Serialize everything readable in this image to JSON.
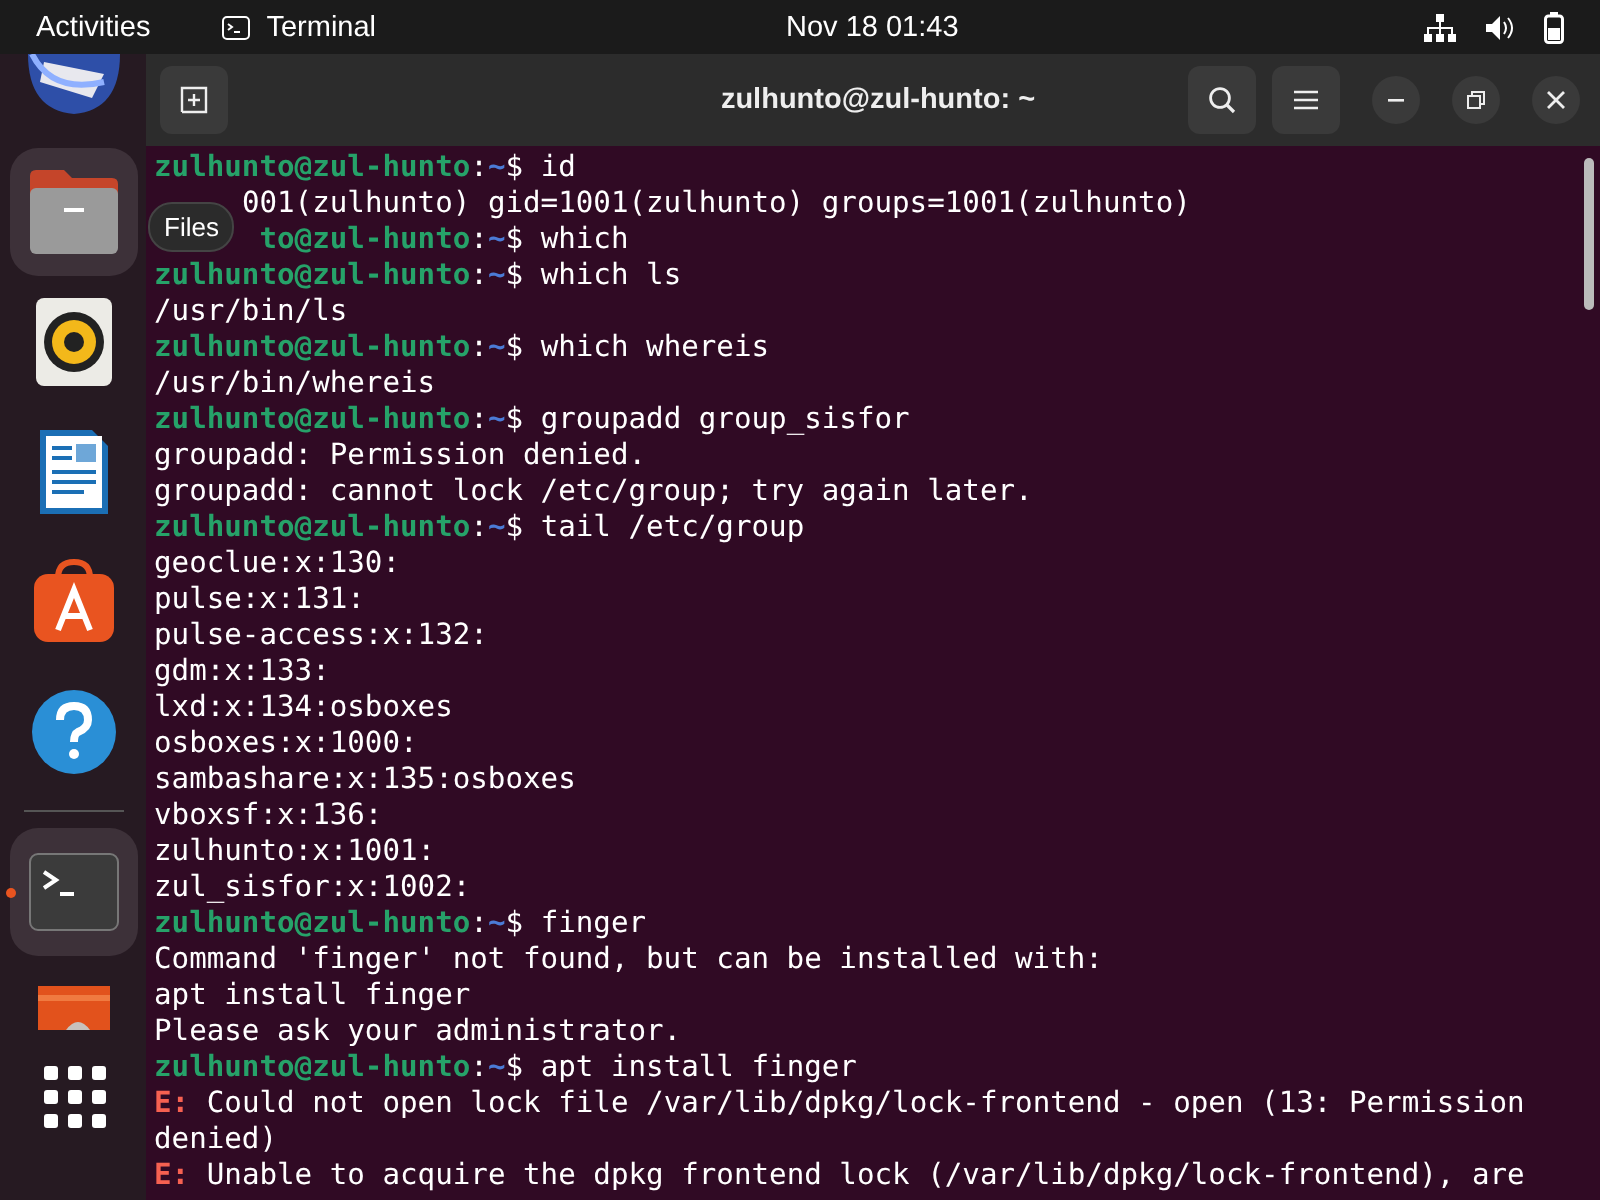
{
  "top_bar": {
    "activities": "Activities",
    "app_name": "Terminal",
    "clock": "Nov 18  01:43"
  },
  "dock": {
    "items": [
      {
        "kind": "mail",
        "selected": false,
        "running": false
      },
      {
        "kind": "files",
        "selected": true,
        "running": false
      },
      {
        "kind": "music",
        "selected": false,
        "running": false
      },
      {
        "kind": "document",
        "selected": false,
        "running": false
      },
      {
        "kind": "store",
        "selected": false,
        "running": false
      },
      {
        "kind": "help",
        "selected": false,
        "running": false
      },
      {
        "kind": "separator"
      },
      {
        "kind": "terminal",
        "selected": true,
        "running": true
      },
      {
        "kind": "partial",
        "selected": false,
        "running": false
      },
      {
        "kind": "grid",
        "selected": false,
        "running": false
      }
    ],
    "tooltip": "Files"
  },
  "window": {
    "title": "zulhunto@zul-hunto: ~"
  },
  "terminal_lines": [
    {
      "kind": "prompt",
      "user": "zulhunto@zul-hunto",
      "sep": ":",
      "path": "~",
      "command": "$ id"
    },
    {
      "kind": "output",
      "text": "     001(zulhunto) gid=1001(zulhunto) groups=1001(zulhunto)"
    },
    {
      "kind": "prompt",
      "user": "      to@zul-hunto",
      "sep": ":",
      "path": "~",
      "command": "$ which"
    },
    {
      "kind": "prompt",
      "user": "zulhunto@zul-hunto",
      "sep": ":",
      "path": "~",
      "command": "$ which ls"
    },
    {
      "kind": "output",
      "text": "/usr/bin/ls"
    },
    {
      "kind": "prompt",
      "user": "zulhunto@zul-hunto",
      "sep": ":",
      "path": "~",
      "command": "$ which whereis"
    },
    {
      "kind": "output",
      "text": "/usr/bin/whereis"
    },
    {
      "kind": "prompt",
      "user": "zulhunto@zul-hunto",
      "sep": ":",
      "path": "~",
      "command": "$ groupadd group_sisfor"
    },
    {
      "kind": "output",
      "text": "groupadd: Permission denied."
    },
    {
      "kind": "output",
      "text": "groupadd: cannot lock /etc/group; try again later."
    },
    {
      "kind": "prompt",
      "user": "zulhunto@zul-hunto",
      "sep": ":",
      "path": "~",
      "command": "$ tail /etc/group"
    },
    {
      "kind": "output",
      "text": "geoclue:x:130:"
    },
    {
      "kind": "output",
      "text": "pulse:x:131:"
    },
    {
      "kind": "output",
      "text": "pulse-access:x:132:"
    },
    {
      "kind": "output",
      "text": "gdm:x:133:"
    },
    {
      "kind": "output",
      "text": "lxd:x:134:osboxes"
    },
    {
      "kind": "output",
      "text": "osboxes:x:1000:"
    },
    {
      "kind": "output",
      "text": "sambashare:x:135:osboxes"
    },
    {
      "kind": "output",
      "text": "vboxsf:x:136:"
    },
    {
      "kind": "output",
      "text": "zulhunto:x:1001:"
    },
    {
      "kind": "output",
      "text": "zul_sisfor:x:1002:"
    },
    {
      "kind": "prompt",
      "user": "zulhunto@zul-hunto",
      "sep": ":",
      "path": "~",
      "command": "$ finger"
    },
    {
      "kind": "output",
      "text": "Command 'finger' not found, but can be installed with:"
    },
    {
      "kind": "output",
      "text": "apt install finger"
    },
    {
      "kind": "output",
      "text": "Please ask your administrator."
    },
    {
      "kind": "prompt",
      "user": "zulhunto@zul-hunto",
      "sep": ":",
      "path": "~",
      "command": "$ apt install finger"
    },
    {
      "kind": "error",
      "tag": "E:",
      "text": "Could not open lock file /var/lib/dpkg/lock-frontend - open (13: Permission"
    },
    {
      "kind": "output",
      "text": "denied)"
    },
    {
      "kind": "error",
      "tag": "E:",
      "text": "Unable to acquire the dpkg frontend lock (/var/lib/dpkg/lock-frontend), are"
    }
  ]
}
